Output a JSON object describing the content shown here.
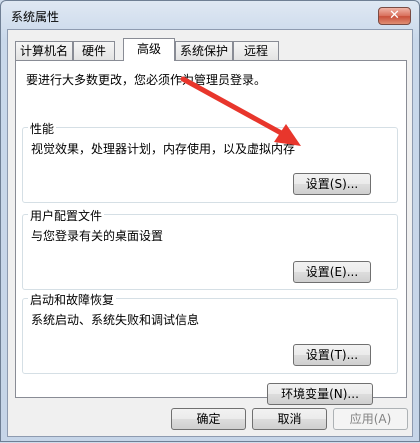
{
  "window": {
    "title": "系统属性",
    "close_glyph": "✕"
  },
  "tabs": [
    {
      "label": "计算机名",
      "active": false
    },
    {
      "label": "硬件",
      "active": false
    },
    {
      "label": "高级",
      "active": true
    },
    {
      "label": "系统保护",
      "active": false
    },
    {
      "label": "远程",
      "active": false
    }
  ],
  "advanced": {
    "admin_note": "要进行大多数更改，您必须作为管理员登录。",
    "performance": {
      "title": "性能",
      "description": "视觉效果，处理器计划，内存使用，以及虚拟内存",
      "button": "设置(S)..."
    },
    "user_profiles": {
      "title": "用户配置文件",
      "description": "与您登录有关的桌面设置",
      "button": "设置(E)..."
    },
    "startup_recovery": {
      "title": "启动和故障恢复",
      "description": "系统启动、系统失败和调试信息",
      "button": "设置(T)..."
    },
    "env_vars_button": "环境变量(N)..."
  },
  "footer": {
    "ok": "确定",
    "cancel": "取消",
    "apply": "应用(A)"
  },
  "colors": {
    "annotation_arrow": "#e8362c"
  }
}
